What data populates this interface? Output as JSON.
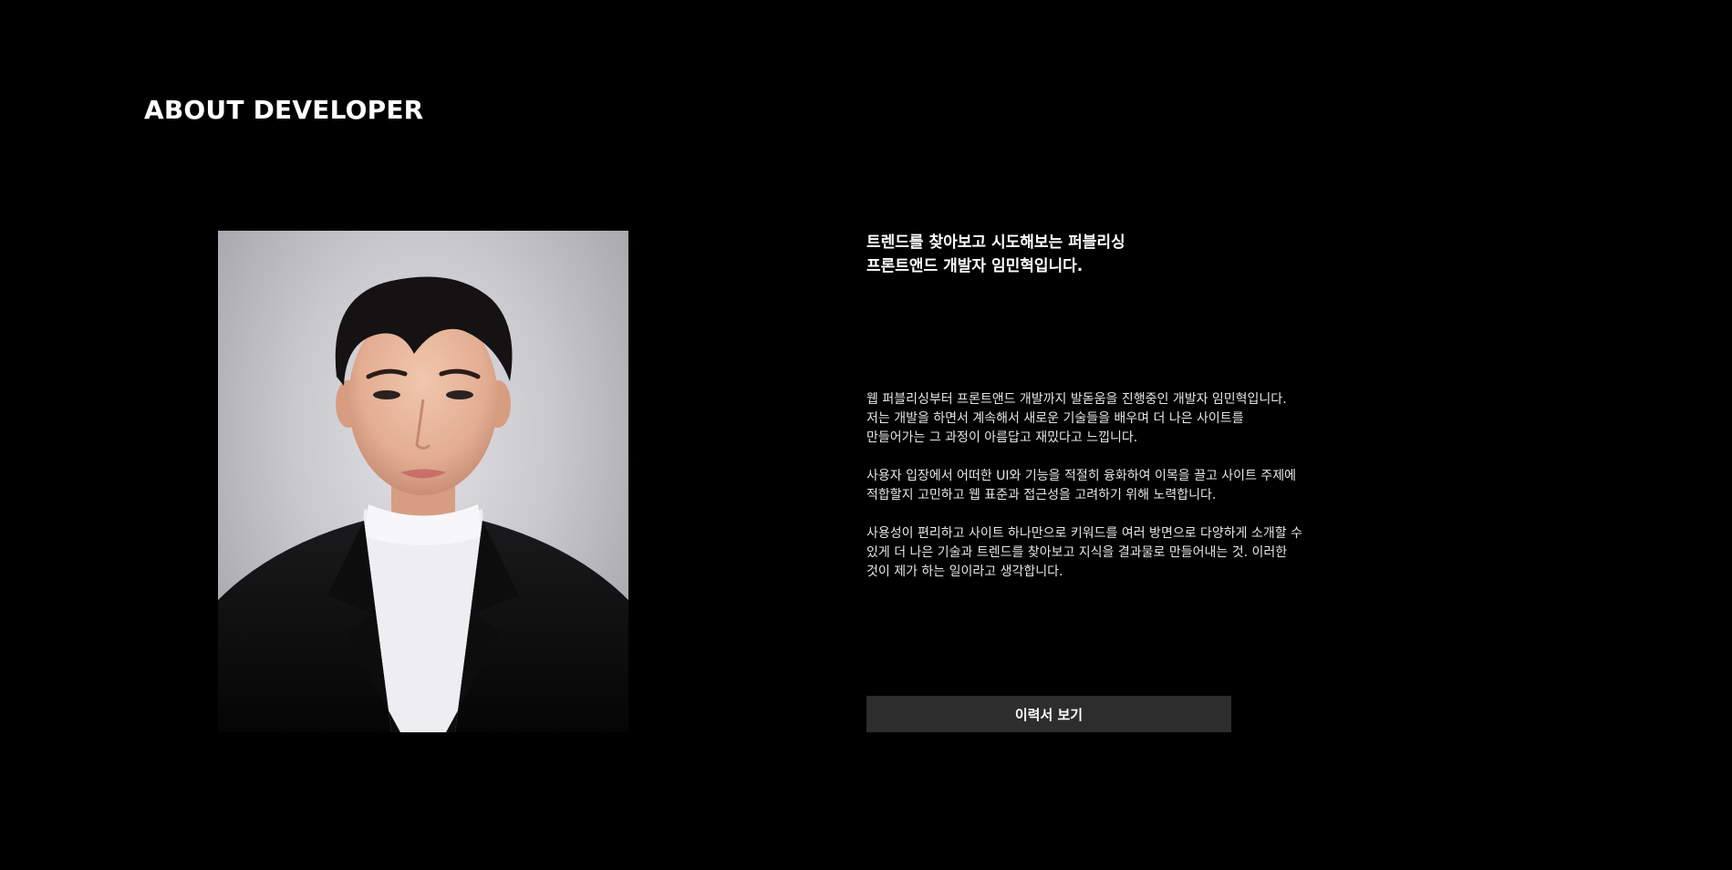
{
  "section": {
    "title": "ABOUT DEVELOPER"
  },
  "profile": {
    "photo_icon": "portrait-photo",
    "headline": "트렌드를 찾아보고 시도해보는 퍼블리싱\n프론트앤드 개발자 임민혁입니다.",
    "paragraphs": [
      "웹 퍼블리싱부터 프론트앤드 개발까지 발돋움을 진행중인 개발자 임민혁입니다.\n저는 개발을 하면서 계속해서 새로운 기술들을 배우며 더 나은 사이트를\n만들어가는 그 과정이 아름답고 재밌다고 느낍니다.",
      "사용자 입장에서 어떠한 UI와 기능을 적절히 융화하여 이목을 끌고 사이트 주제에\n적합할지 고민하고 웹 표준과 접근성을 고려하기 위해 노력합니다.",
      "사용성이 편리하고 사이트 하나만으로 키워드를 여러 방면으로 다양하게 소개할 수\n있게 더 나은 기술과 트렌드를 찾아보고 지식을 결과물로 만들어내는 것. 이러한\n것이 제가 하는 일이라고 생각합니다."
    ],
    "resume_button_label": "이력서 보기"
  },
  "colors": {
    "background": "#000000",
    "text": "#ffffff",
    "button_background": "#2d2d2d"
  }
}
